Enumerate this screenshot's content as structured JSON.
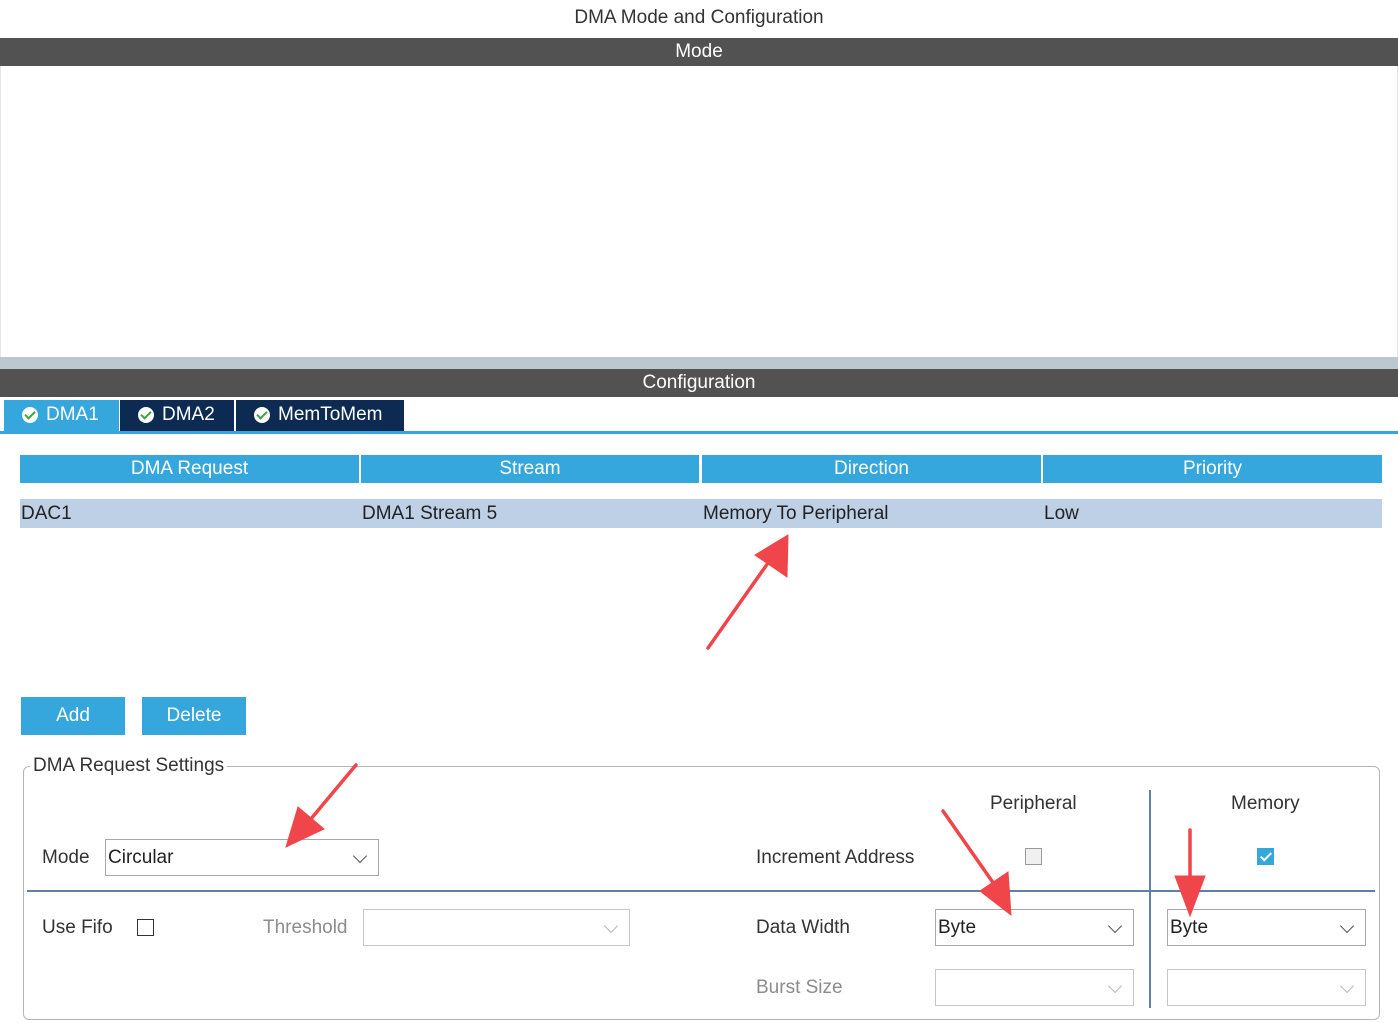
{
  "page_title": "DMA Mode and Configuration",
  "mode_header": "Mode",
  "config_header": "Configuration",
  "tabs": [
    {
      "label": "DMA1",
      "active": true
    },
    {
      "label": "DMA2",
      "active": false
    },
    {
      "label": "MemToMem",
      "active": false
    }
  ],
  "table": {
    "headers": [
      "DMA Request",
      "Stream",
      "Direction",
      "Priority"
    ],
    "rows": [
      [
        "DAC1",
        "DMA1 Stream 5",
        "Memory To Peripheral",
        "Low"
      ]
    ]
  },
  "buttons": {
    "add": "Add",
    "delete": "Delete"
  },
  "settings": {
    "legend": "DMA Request Settings",
    "peripheral_header": "Peripheral",
    "memory_header": "Memory",
    "mode_label": "Mode",
    "mode_value": "Circular",
    "increment_address_label": "Increment Address",
    "increment_peripheral_checked": false,
    "increment_memory_checked": true,
    "use_fifo_label": "Use Fifo",
    "use_fifo_checked": false,
    "threshold_label": "Threshold",
    "threshold_value": "",
    "data_width_label": "Data Width",
    "data_width_peripheral": "Byte",
    "data_width_memory": "Byte",
    "burst_size_label": "Burst Size",
    "burst_size_peripheral": "",
    "burst_size_memory": ""
  },
  "colors": {
    "accent": "#36a7dd",
    "header_bar": "#525252",
    "tab_inactive": "#0d2b52",
    "row_selected": "#bdd0e6",
    "annotation_arrow": "#f0454a"
  },
  "icons": {
    "tab_status": "check-circle-icon",
    "select": "chevron-down-icon",
    "annotation": "arrow-annotation-icon"
  }
}
